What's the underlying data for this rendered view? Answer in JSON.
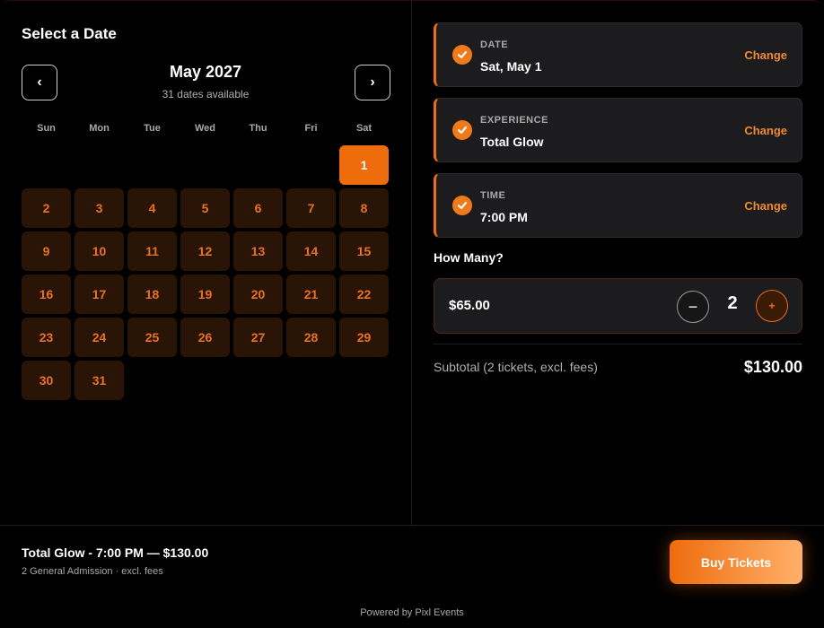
{
  "calendar": {
    "title": "Select a Date",
    "prev_label": "‹",
    "next_label": "›",
    "month": "May 2027",
    "availability": "31 dates available",
    "weekdays": [
      "Sun",
      "Mon",
      "Tue",
      "Wed",
      "Thu",
      "Fri",
      "Sat"
    ],
    "leading_blanks": 6,
    "days": [
      "1",
      "2",
      "3",
      "4",
      "5",
      "6",
      "7",
      "8",
      "9",
      "10",
      "11",
      "12",
      "13",
      "14",
      "15",
      "16",
      "17",
      "18",
      "19",
      "20",
      "21",
      "22",
      "23",
      "24",
      "25",
      "26",
      "27",
      "28",
      "29",
      "30",
      "31"
    ],
    "selected_day": "1"
  },
  "summary": {
    "cards": [
      {
        "label": "DATE",
        "value": "Sat, May 1",
        "action": "Change"
      },
      {
        "label": "EXPERIENCE",
        "value": "Total Glow",
        "action": "Change"
      },
      {
        "label": "TIME",
        "value": "7:00 PM",
        "action": "Change"
      }
    ],
    "icon": "check-circle-icon"
  },
  "quantity": {
    "heading": "How Many?",
    "price": "$65.00",
    "minus_label": "−",
    "count": "2",
    "plus_label": "+"
  },
  "subtotal": {
    "label": "Subtotal (2 tickets, excl. fees)",
    "value": "$130.00"
  },
  "footer": {
    "title": "Total Glow - 7:00 PM — $130.00",
    "subtitle": "2 General Admission · excl. fees",
    "buy_label": "Buy Tickets",
    "powered_by": "Powered by Pixl Events"
  },
  "colors": {
    "accent": "#ee6c0c",
    "day_bg": "#2a1406",
    "card_bg": "#1c1c1e"
  }
}
